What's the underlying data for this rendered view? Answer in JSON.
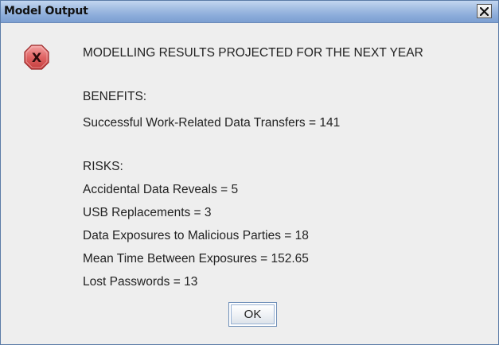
{
  "window": {
    "title": "Model Output",
    "close_icon": "close-x-icon"
  },
  "dialog": {
    "icon": "error-icon",
    "icon_glyph": "X",
    "icon_color": "#d94b4b",
    "lines": [
      "MODELLING RESULTS PROJECTED FOR THE NEXT YEAR",
      "BENEFITS:",
      "Successful Work-Related Data Transfers = 141",
      "RISKS:",
      "Accidental Data Reveals = 5",
      "USB Replacements = 3",
      "Data Exposures to Malicious Parties = 18",
      "Mean Time Between Exposures = 152.65",
      "Lost Passwords = 13"
    ],
    "ok_label": "OK"
  }
}
